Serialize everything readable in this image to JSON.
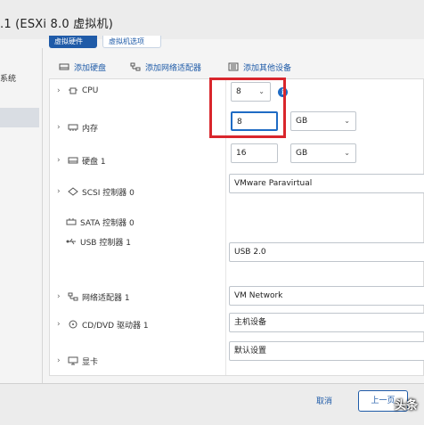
{
  "window": {
    "title": ".1 (ESXi 8.0 虚拟机)"
  },
  "tabs": [
    {
      "label": "虚拟硬件"
    },
    {
      "label": "虚拟机选项"
    }
  ],
  "left_nav": [
    {
      "label": "系统"
    },
    {
      "label": ""
    }
  ],
  "toolbar": {
    "add_disk": "添加硬盘",
    "add_nic": "添加网络适配器",
    "add_other": "添加其他设备"
  },
  "hardware": {
    "cpu": {
      "label": "CPU",
      "value": "8"
    },
    "memory": {
      "label": "内存",
      "value": "8",
      "unit": "GB"
    },
    "disk": {
      "label": "硬盘 1",
      "value": "16",
      "unit": "GB"
    },
    "scsi": {
      "label": "SCSI 控制器 0",
      "value": "VMware Paravirtual"
    },
    "sata": {
      "label": "SATA 控制器 0"
    },
    "usb": {
      "label": "USB 控制器 1",
      "value": "USB 2.0"
    },
    "nic": {
      "label": "网络适配器 1",
      "value": "VM Network"
    },
    "cdrom": {
      "label": "CD/DVD 驱动器 1",
      "value": "主机设备"
    },
    "video": {
      "label": "显卡",
      "value": "默认设置"
    }
  },
  "footer": {
    "cancel": "取消",
    "prev": "上一页"
  },
  "watermark": "头条",
  "colors": {
    "accent": "#1f5ba8",
    "highlight": "#d9262c"
  }
}
